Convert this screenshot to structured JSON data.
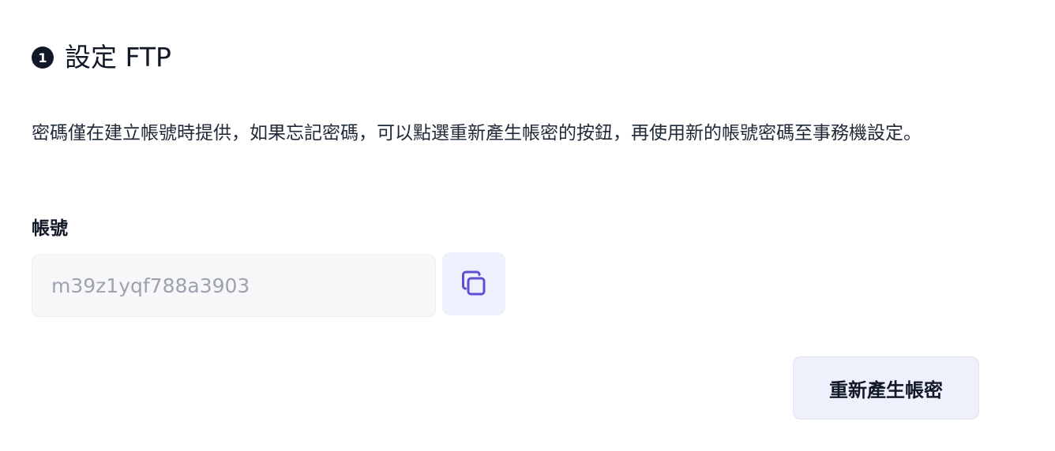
{
  "step": {
    "number": "1",
    "title": "設定 FTP"
  },
  "description": "密碼僅在建立帳號時提供，如果忘記密碼，可以點選重新產生帳密的按鈕，再使用新的帳號密碼至事務機設定。",
  "account": {
    "label": "帳號",
    "value": "m39z1yqf788a3903"
  },
  "icons": {
    "copy": "copy-icon"
  },
  "actions": {
    "regenerate_label": "重新產生帳密"
  },
  "colors": {
    "accent": "#5b4fd6",
    "button_bg": "#eef0fc",
    "input_bg": "#f7f7f9",
    "text": "#111827"
  }
}
